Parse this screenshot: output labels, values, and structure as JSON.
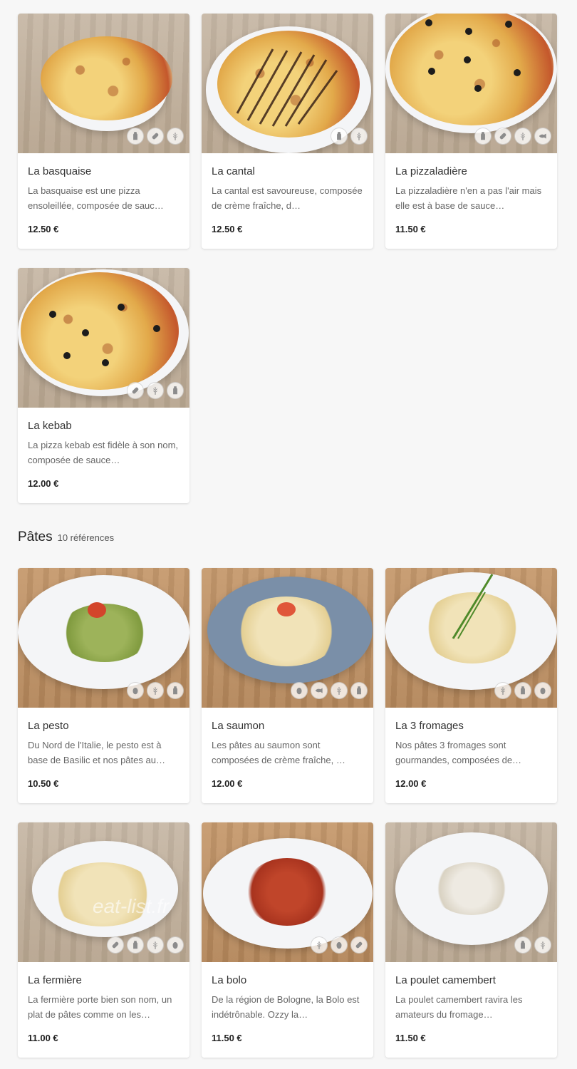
{
  "pizzas": [
    {
      "name": "La basquaise",
      "desc": "La basquaise est une pizza ensoleillée, composée de sauc…",
      "price": "12.50 €",
      "icons": [
        "milk-icon",
        "sausage-icon",
        "wheat-icon"
      ]
    },
    {
      "name": "La cantal",
      "desc": "La cantal est savoureuse, composée de crème fraîche, d…",
      "price": "12.50 €",
      "icons": [
        "milk-icon",
        "wheat-icon"
      ]
    },
    {
      "name": "La pizzaladière",
      "desc": "La pizzaladière n'en a pas l'air mais elle est à base de sauce…",
      "price": "11.50 €",
      "icons": [
        "milk-icon",
        "sausage-icon",
        "wheat-icon",
        "fish-icon"
      ]
    },
    {
      "name": "La kebab",
      "desc": "La pizza kebab est fidèle à son nom, composée de sauce…",
      "price": "12.00 €",
      "icons": [
        "sausage-icon",
        "wheat-icon",
        "milk-icon"
      ]
    }
  ],
  "pates_section": {
    "title": "Pâtes",
    "count": "10 références"
  },
  "pates": [
    {
      "name": "La pesto",
      "desc": "Du Nord de l'Italie, le pesto est à base de Basilic et nos pâtes au…",
      "price": "10.50 €",
      "icons": [
        "egg-icon",
        "wheat-icon",
        "milk-icon"
      ]
    },
    {
      "name": "La saumon",
      "desc": "Les pâtes au saumon sont composées de crème fraîche, …",
      "price": "12.00 €",
      "icons": [
        "egg-icon",
        "fish-icon",
        "wheat-icon",
        "milk-icon"
      ]
    },
    {
      "name": "La 3 fromages",
      "desc": "Nos pâtes 3 fromages sont gourmandes, composées de…",
      "price": "12.00 €",
      "icons": [
        "wheat-icon",
        "milk-icon",
        "egg-icon"
      ]
    },
    {
      "name": "La fermière",
      "desc": "La fermière porte bien son nom, un plat de pâtes comme on les…",
      "price": "11.00 €",
      "icons": [
        "sausage-icon",
        "milk-icon",
        "wheat-icon",
        "egg-icon"
      ]
    },
    {
      "name": "La bolo",
      "desc": "De la région de Bologne, la Bolo est indétrônable. Ozzy la…",
      "price": "11.50 €",
      "icons": [
        "wheat-icon",
        "egg-icon",
        "sausage-icon"
      ]
    },
    {
      "name": "La poulet camembert",
      "desc": "La poulet camembert ravira les amateurs du fromage…",
      "price": "11.50 €",
      "icons": [
        "milk-icon",
        "wheat-icon"
      ]
    }
  ],
  "watermark": "eat-list.fr"
}
